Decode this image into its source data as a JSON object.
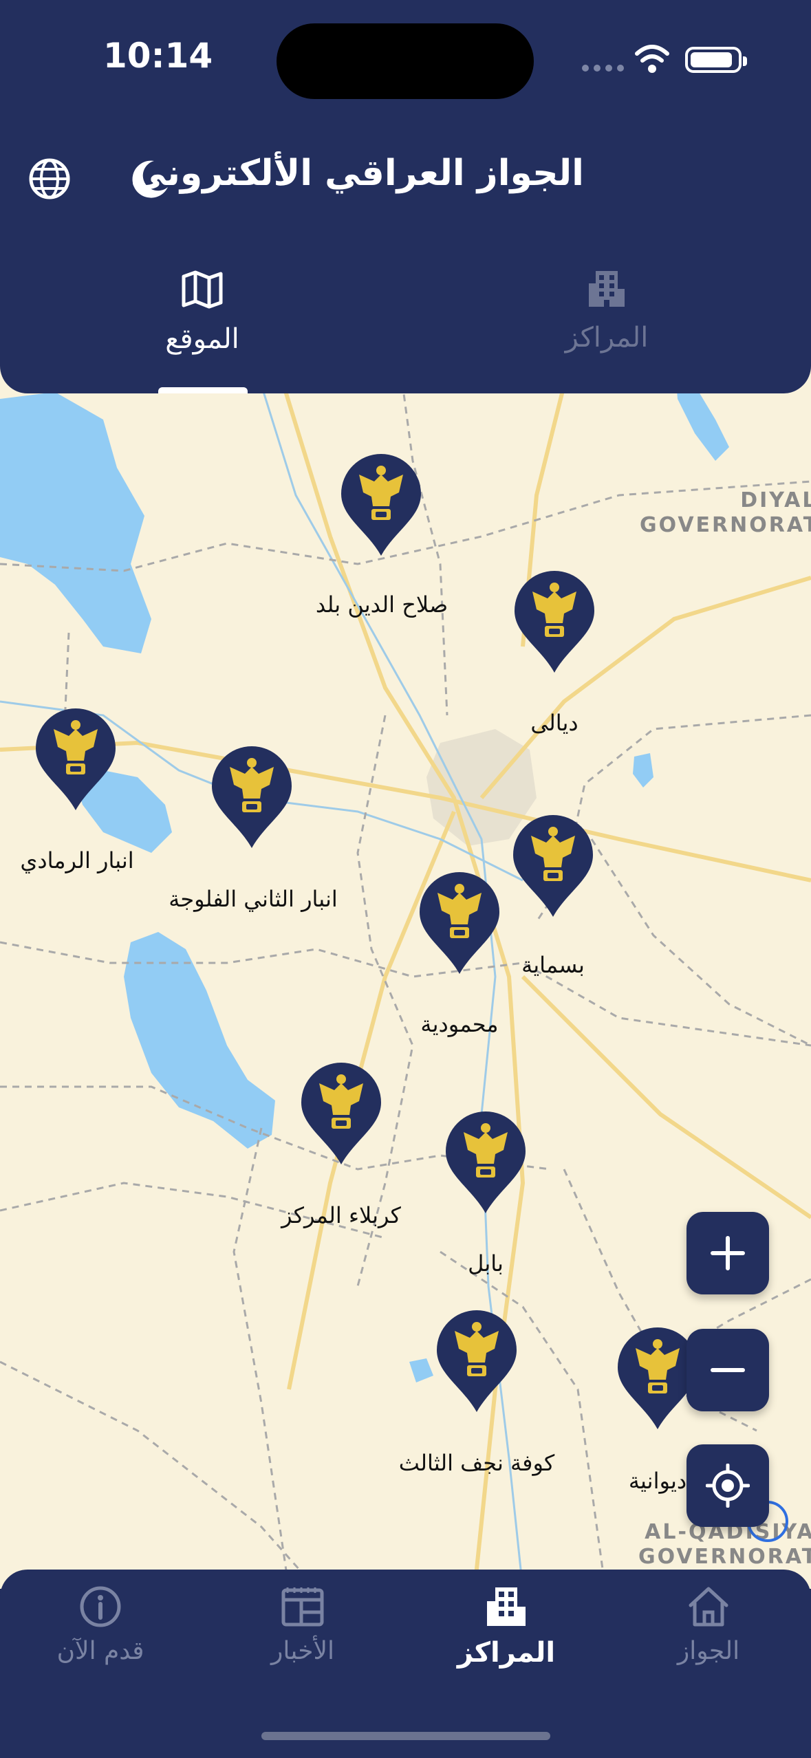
{
  "status_bar": {
    "time": "10:14"
  },
  "header": {
    "title": "الجواز العراقي الألكتروني",
    "language_icon": "globe-icon",
    "theme_icon": "moon-icon"
  },
  "tabs": [
    {
      "label": "الموقع",
      "icon": "map-icon",
      "active": true
    },
    {
      "label": "المراكز",
      "icon": "building-icon",
      "active": false
    }
  ],
  "map": {
    "region_labels": [
      {
        "lines": [
          "DIYALA",
          "GOVERNORATE"
        ]
      },
      {
        "lines": [
          "AL-QADISIYAH",
          "GOVERNORATE"
        ]
      }
    ],
    "centers": [
      {
        "name": "صلاح الدين  بلد"
      },
      {
        "name": "ديالى"
      },
      {
        "name": "انبار الرمادي"
      },
      {
        "name": "انبار الثاني الفلوجة"
      },
      {
        "name": "بسماية"
      },
      {
        "name": "محمودية"
      },
      {
        "name": "كربلاء المركز"
      },
      {
        "name": "بابل"
      },
      {
        "name": "كوفة نجف الثالث"
      },
      {
        "name": "ديوانية"
      }
    ],
    "controls": {
      "zoom_in": "plus-icon",
      "zoom_out": "minus-icon",
      "locate": "crosshair-icon"
    }
  },
  "bottom_nav": [
    {
      "label": "قدم الآن",
      "icon": "info-icon",
      "active": false
    },
    {
      "label": "الأخبار",
      "icon": "news-icon",
      "active": false
    },
    {
      "label": "المراكز",
      "icon": "buildings-icon",
      "active": true
    },
    {
      "label": "الجواز",
      "icon": "home-icon",
      "active": false
    }
  ],
  "colors": {
    "primary": "#232f5e",
    "map_land": "#f9f2dc",
    "water": "#92ccf4",
    "pin_emblem": "#e7c23a"
  }
}
